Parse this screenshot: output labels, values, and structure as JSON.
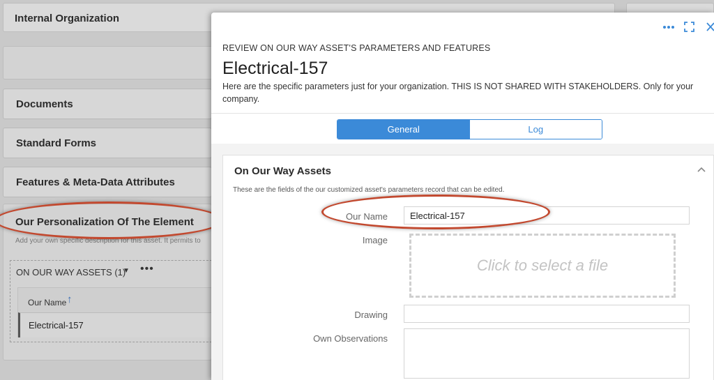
{
  "background": {
    "internal_org_title": "Internal Organization",
    "documents_title": "Documents",
    "standard_forms_title": "Standard Forms",
    "features_title": "Features & Meta-Data Attributes",
    "personalization_title": "Our Personalization Of The Element",
    "personalization_desc": "Add your own specific description for this asset. It permits to",
    "assets_header": "ON OUR WAY ASSETS (1)",
    "column_header": "Our Name",
    "row_value": "Electrical-157"
  },
  "panel": {
    "kicker": "REVIEW ON OUR WAY ASSET'S PARAMETERS AND FEATURES",
    "title": "Electrical-157",
    "description": "Here are the specific parameters just for your organization. THIS IS NOT SHARED WITH STAKEHOLDERS. Only for your company.",
    "tabs": [
      {
        "label": "General",
        "active": true
      },
      {
        "label": "Log",
        "active": false
      }
    ],
    "section": {
      "title": "On Our Way Assets",
      "subtitle": "These are the fields of the our customized asset's parameters record that can be edited.",
      "fields": {
        "our_name_label": "Our Name",
        "our_name_value": "Electrical-157",
        "image_label": "Image",
        "image_placeholder": "Click to select a file",
        "drawing_label": "Drawing",
        "drawing_value": "",
        "observations_label": "Own Observations",
        "observations_value": ""
      }
    }
  },
  "colors": {
    "accent": "#3b8ad8",
    "highlight_ring": "#c2492f"
  }
}
